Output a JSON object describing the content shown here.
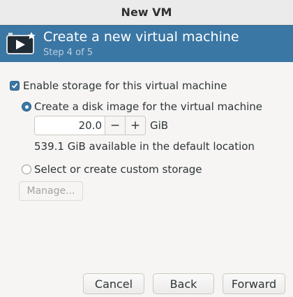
{
  "window": {
    "title": "New VM"
  },
  "banner": {
    "heading": "Create a new virtual machine",
    "step": "Step 4 of 5",
    "icon": "monitor-play-icon"
  },
  "storage": {
    "enable_label": "Enable storage for this virtual machine",
    "enable_checked": true,
    "create_disk_label": "Create a disk image for the virtual machine",
    "create_disk_selected": true,
    "size_value": "20.0",
    "decrement_label": "−",
    "increment_label": "+",
    "unit": "GiB",
    "available_text": "539.1 GiB available in the default location",
    "custom_label": "Select or create custom storage",
    "manage_label": "Manage..."
  },
  "buttons": {
    "cancel": "Cancel",
    "back": "Back",
    "forward": "Forward"
  },
  "colors": {
    "accent": "#3b77a4",
    "banner_step": "#b8cfe1"
  }
}
